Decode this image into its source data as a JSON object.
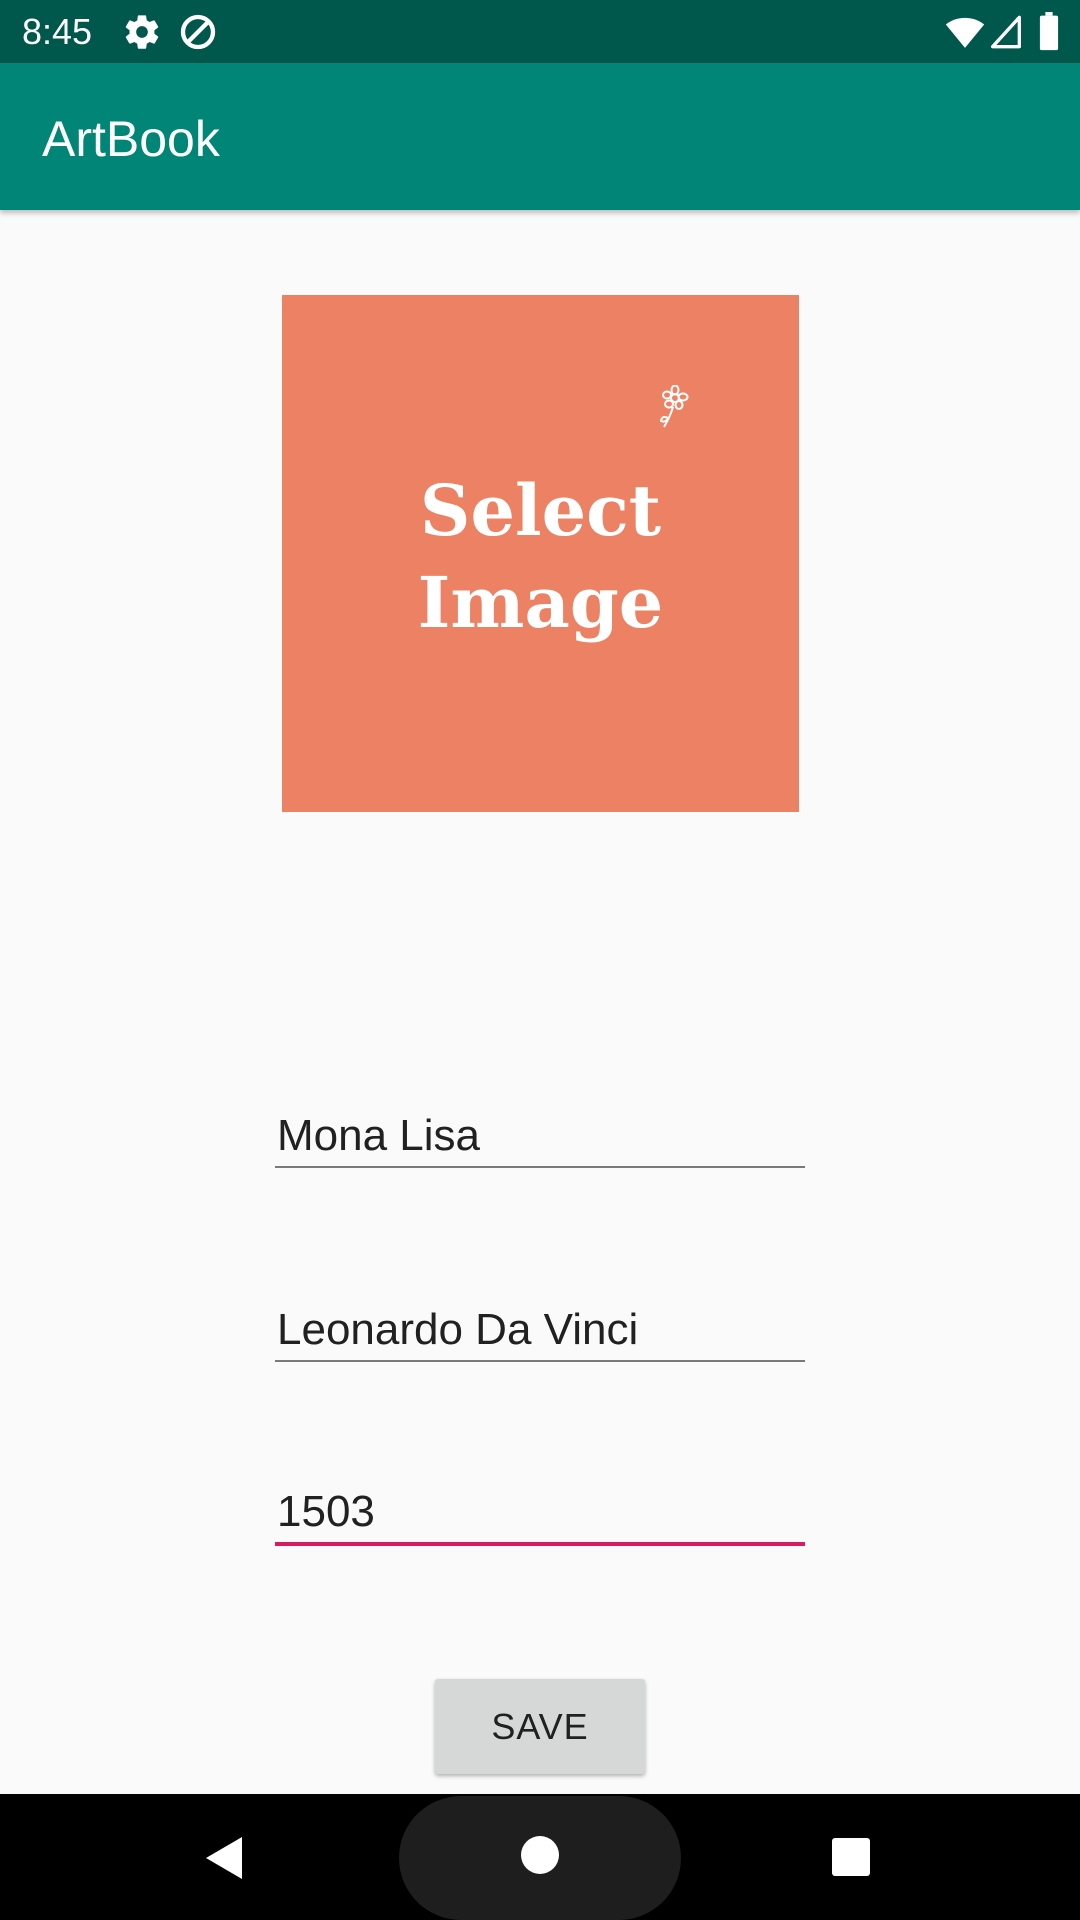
{
  "status_bar": {
    "time": "8:45",
    "icons": [
      "settings-icon",
      "data-saver-icon",
      "wifi-icon",
      "cellular-signal-icon",
      "battery-icon"
    ],
    "background": "#00574b"
  },
  "app_bar": {
    "title": "ArtBook",
    "background": "#008577"
  },
  "image_picker": {
    "line1": "Select",
    "line2": "Image",
    "background": "#ec8163",
    "icon": "flower-icon"
  },
  "form": {
    "art_name": {
      "value": "Mona Lisa"
    },
    "artist_name": {
      "value": "Leonardo Da Vinci"
    },
    "year": {
      "value": "1503",
      "focused": true
    },
    "accent_color": "#d81b60"
  },
  "save_button": {
    "label": "SAVE"
  },
  "nav_bar": {
    "icons": [
      "back-icon",
      "home-icon",
      "recents-icon"
    ]
  }
}
